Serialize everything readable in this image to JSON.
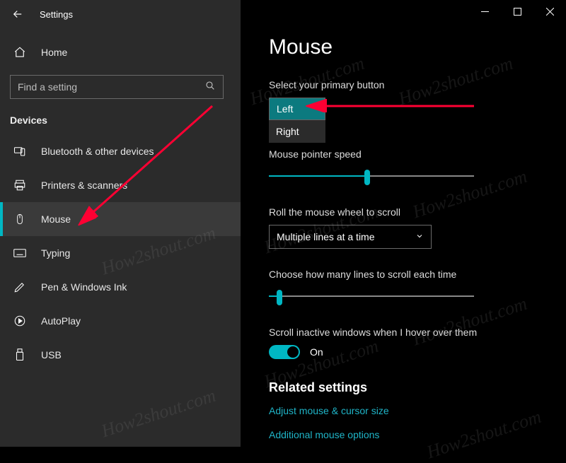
{
  "app_title": "Settings",
  "home_label": "Home",
  "search_placeholder": "Find a setting",
  "category": "Devices",
  "nav": [
    {
      "label": "Bluetooth & other devices"
    },
    {
      "label": "Printers & scanners"
    },
    {
      "label": "Mouse"
    },
    {
      "label": "Typing"
    },
    {
      "label": "Pen & Windows Ink"
    },
    {
      "label": "AutoPlay"
    },
    {
      "label": "USB"
    }
  ],
  "page": {
    "title": "Mouse",
    "primary_label": "Select your primary button",
    "primary_options": {
      "selected": "Left",
      "other": "Right"
    },
    "pointer_speed_label": "Mouse pointer speed",
    "pointer_speed_pct": 48,
    "wheel_label": "Roll the mouse wheel to scroll",
    "wheel_selected": "Multiple lines at a time",
    "lines_label": "Choose how many lines to scroll each time",
    "lines_pct": 5,
    "inactive_label": "Scroll inactive windows when I hover over them",
    "toggle_state": "On",
    "related_heading": "Related settings",
    "link1": "Adjust mouse & cursor size",
    "link2": "Additional mouse options"
  },
  "watermark_text": "How2shout.com"
}
